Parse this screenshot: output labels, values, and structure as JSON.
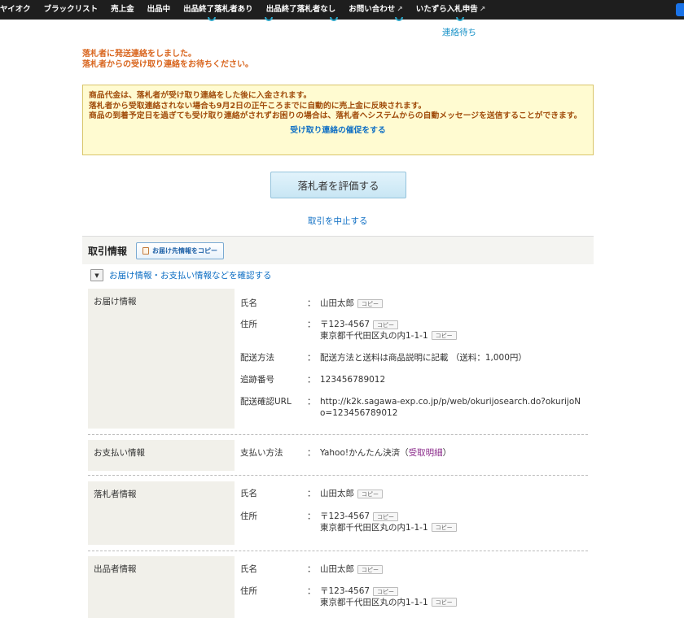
{
  "nav": {
    "items": [
      "ヤイオク",
      "ブラックリスト",
      "売上金",
      "出品中",
      "出品終了落札者あり",
      "出品終了落札者なし",
      "お問い合わせ",
      "いたずら入札申告"
    ],
    "ext_icon": "↗"
  },
  "progress": {
    "step_label": "連絡待ち"
  },
  "notice": {
    "line1": "落札者に発送連絡をしました。",
    "line2": "落札者からの受け取り連絡をお待ちください。"
  },
  "info": {
    "line1": "商品代金は、落札者が受け取り連絡をした後に入金されます。",
    "line2": "落札者から受取連絡されない場合も9月2日の正午ころまでに自動的に売上金に反映されます。",
    "line3": "商品の到着予定日を過ぎても受け取り連絡がされずお困りの場合は、落札者へシステムからの自動メッセージを送信することができます。",
    "link": "受け取り連絡の催促をする"
  },
  "rate_button": "落札者を評価する",
  "cancel_link": "取引を中止する",
  "trade": {
    "title": "取引情報",
    "copy_button": "お届け先情報をコピー",
    "expander": "お届け情報・お支払い情報などを確認する",
    "copy_label": "コピー",
    "colon": "：",
    "delivery": {
      "label": "お届け情報",
      "name_key": "氏名",
      "name": "山田太郎",
      "addr_key": "住所",
      "postal": "〒123-4567",
      "address": "東京都千代田区丸の内1-1-1",
      "method_key": "配送方法",
      "method": "配送方法と送料は商品説明に記載 （送料：1,000円）",
      "track_key": "追跡番号",
      "track": "123456789012",
      "url_key": "配送確認URL",
      "url": "http://k2k.sagawa-exp.co.jp/p/web/okurijosearch.do?okurijoNo=123456789012"
    },
    "payment": {
      "label": "お支払い情報",
      "method_key": "支払い方法",
      "method": "Yahoo!かんたん決済（",
      "detail_link": "受取明細",
      "close": "）"
    },
    "buyer": {
      "label": "落札者情報",
      "name_key": "氏名",
      "name": "山田太郎",
      "addr_key": "住所",
      "postal": "〒123-4567",
      "address": "東京都千代田区丸の内1-1-1"
    },
    "seller": {
      "label": "出品者情報",
      "name_key": "氏名",
      "name": "山田太郎",
      "addr_key": "住所",
      "postal": "〒123-4567",
      "address": "東京都千代田区丸の内1-1-1"
    }
  }
}
